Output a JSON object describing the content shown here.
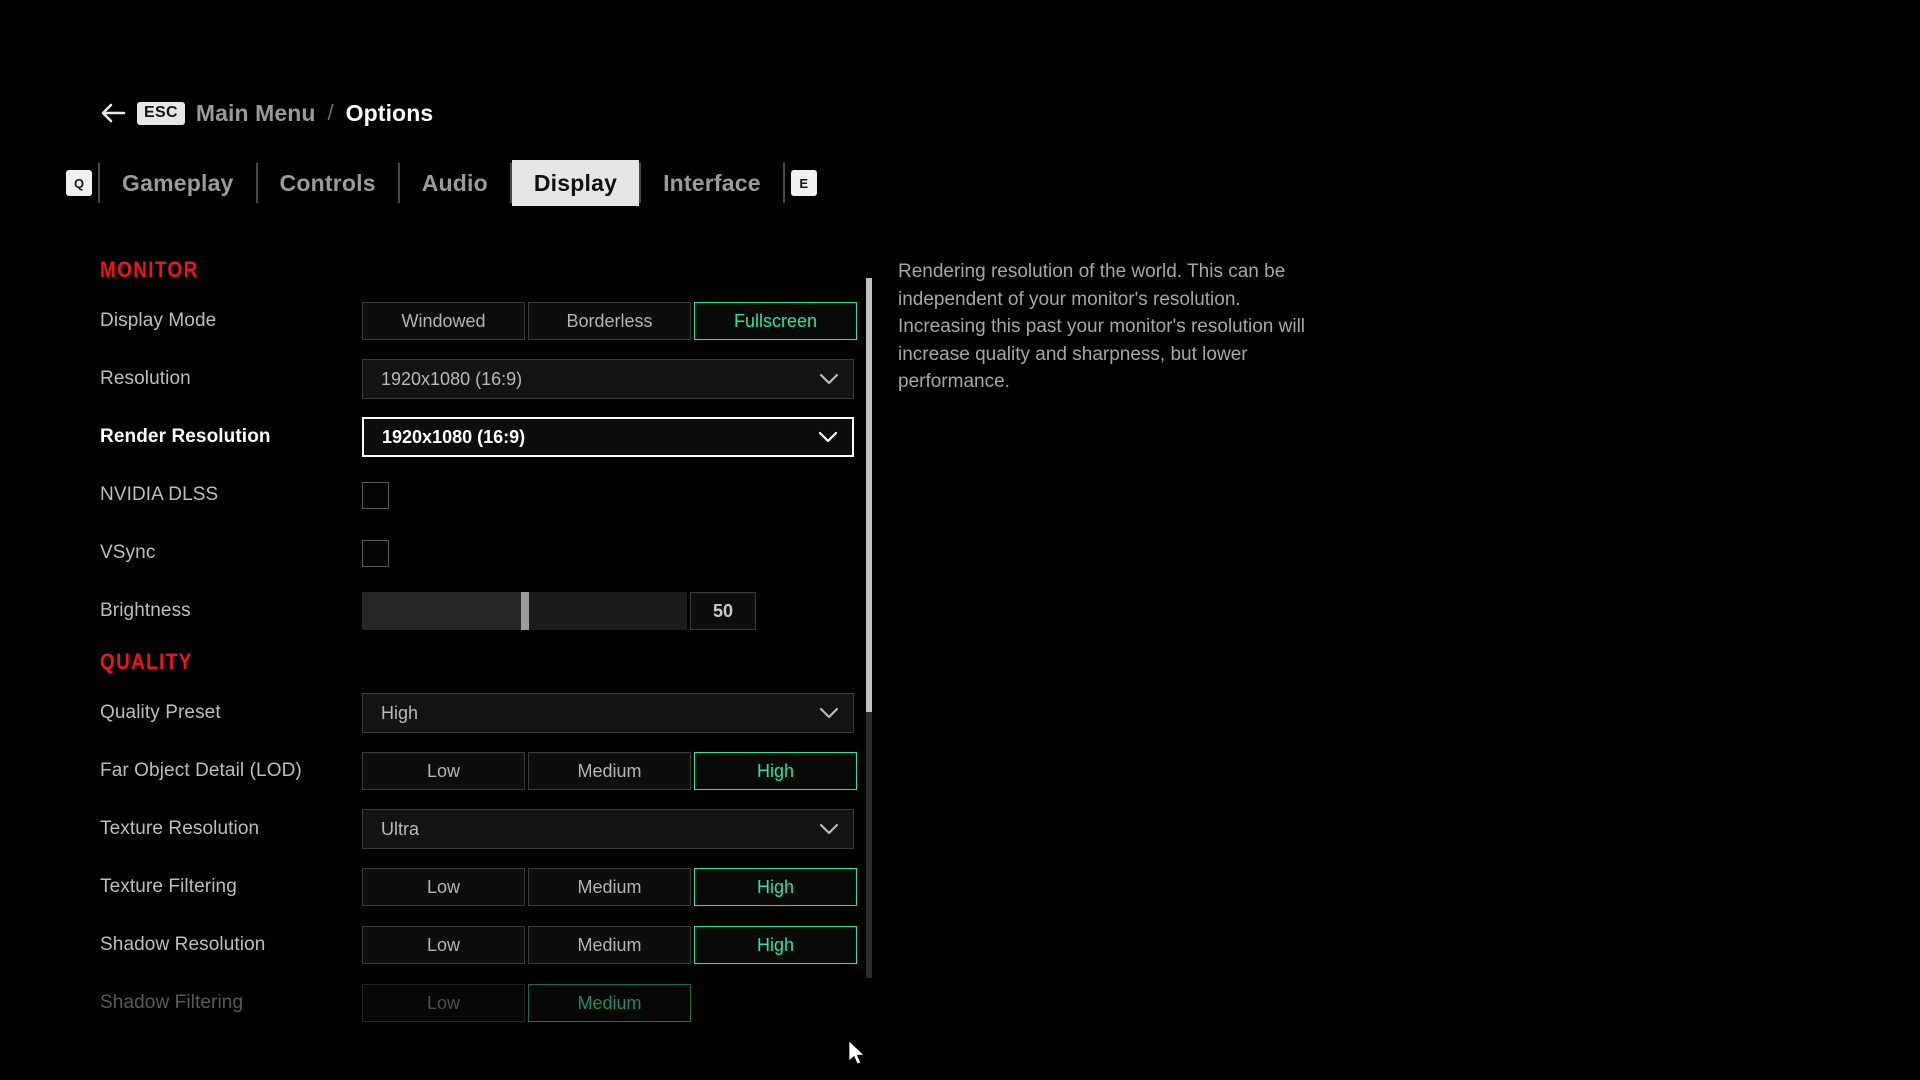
{
  "breadcrumb": {
    "back_icon": "back-arrow-icon",
    "esc_key": "ESC",
    "parent": "Main Menu",
    "separator": "/",
    "current": "Options"
  },
  "tabbar": {
    "prev_key": "Q",
    "next_key": "E",
    "tabs": [
      {
        "label": "Gameplay",
        "active": false
      },
      {
        "label": "Controls",
        "active": false
      },
      {
        "label": "Audio",
        "active": false
      },
      {
        "label": "Display",
        "active": true
      },
      {
        "label": "Interface",
        "active": false
      }
    ]
  },
  "sections": [
    {
      "title": "MONITOR",
      "rows": [
        {
          "label": "Display Mode",
          "type": "segmented",
          "options": [
            "Windowed",
            "Borderless",
            "Fullscreen"
          ],
          "selected": "Fullscreen",
          "state": "normal"
        },
        {
          "label": "Resolution",
          "type": "dropdown",
          "value": "1920x1080 (16:9)",
          "state": "normal"
        },
        {
          "label": "Render Resolution",
          "type": "dropdown",
          "value": "1920x1080 (16:9)",
          "state": "focused"
        },
        {
          "label": "NVIDIA DLSS",
          "type": "checkbox",
          "checked": false,
          "state": "normal"
        },
        {
          "label": "VSync",
          "type": "checkbox",
          "checked": false,
          "state": "normal"
        },
        {
          "label": "Brightness",
          "type": "slider",
          "value": "50",
          "min": 0,
          "max": 100,
          "state": "normal"
        }
      ]
    },
    {
      "title": "QUALITY",
      "rows": [
        {
          "label": "Quality Preset",
          "type": "dropdown",
          "value": "High",
          "state": "normal"
        },
        {
          "label": "Far Object Detail (LOD)",
          "type": "segmented",
          "options": [
            "Low",
            "Medium",
            "High"
          ],
          "selected": "High",
          "state": "normal"
        },
        {
          "label": "Texture Resolution",
          "type": "dropdown",
          "value": "Ultra",
          "state": "normal"
        },
        {
          "label": "Texture Filtering",
          "type": "segmented",
          "options": [
            "Low",
            "Medium",
            "High"
          ],
          "selected": "High",
          "state": "normal"
        },
        {
          "label": "Shadow Resolution",
          "type": "segmented",
          "options": [
            "Low",
            "Medium",
            "High"
          ],
          "selected": "High",
          "state": "normal"
        },
        {
          "label": "Shadow Filtering",
          "type": "segmented",
          "options": [
            "Low",
            "Medium"
          ],
          "selected": "Medium",
          "state": "disabled"
        }
      ]
    }
  ],
  "description": "Rendering resolution of the world. This can be independent of your monitor's resolution. Increasing this past your monitor's resolution will increase quality and sharpness, but lower performance.",
  "scrollbar": {
    "thumb_top_pct": 0,
    "thumb_height_pct": 62
  },
  "colors": {
    "accent_selected": "#2ee0a5",
    "section_header": "#ee1520",
    "tab_active_bg": "#e6e6e6",
    "focus_border": "#ffffff"
  }
}
